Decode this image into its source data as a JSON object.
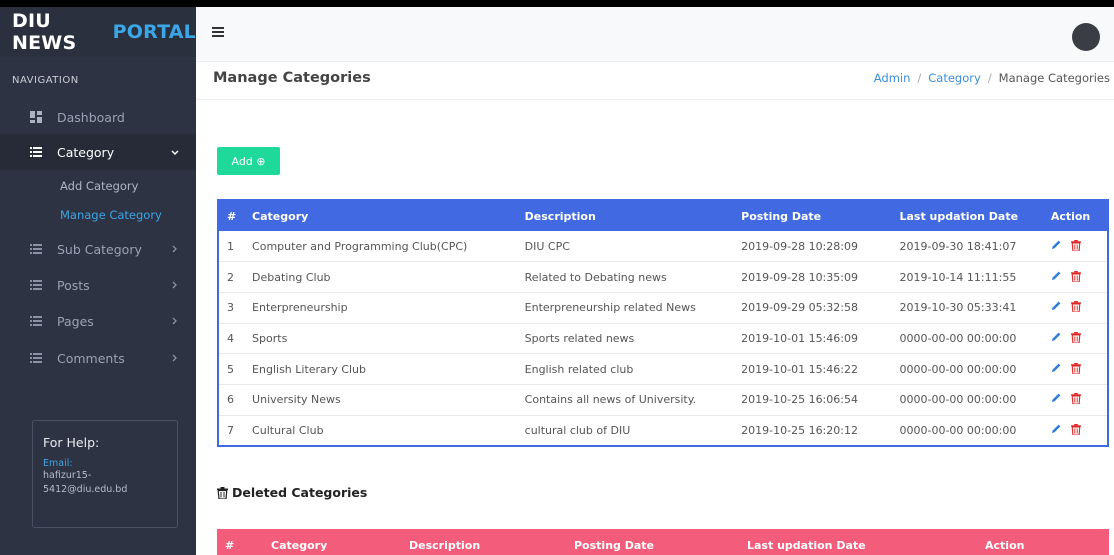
{
  "brand": {
    "primary": "DIU NEWS",
    "accent": "PORTAL"
  },
  "sidebar": {
    "nav_header": "NAVIGATION",
    "items": [
      {
        "label": "Dashboard",
        "icon": "dashboard-icon"
      },
      {
        "label": "Category",
        "icon": "list-icon",
        "expanded": true
      },
      {
        "label": "Sub Category",
        "icon": "list-icon"
      },
      {
        "label": "Posts",
        "icon": "list-icon"
      },
      {
        "label": "Pages",
        "icon": "list-icon"
      },
      {
        "label": "Comments",
        "icon": "list-icon"
      }
    ],
    "category_sub": [
      {
        "label": "Add Category"
      },
      {
        "label": "Manage Category"
      }
    ],
    "help": {
      "title": "For Help:",
      "email_label": "Email:",
      "email_line1": "hafizur15-",
      "email_line2": "5412@diu.edu.bd"
    }
  },
  "header": {
    "page_title": "Manage Categories",
    "breadcrumb": [
      "Admin",
      "Category",
      "Manage Categories"
    ]
  },
  "main": {
    "add_button": "Add ⊕",
    "table": {
      "headers": [
        "#",
        "Category",
        "Description",
        "Posting Date",
        "Last updation Date",
        "Action"
      ],
      "rows": [
        [
          "1",
          "Computer and Programming Club(CPC)",
          "DIU CPC",
          "2019-09-28 10:28:09",
          "2019-09-30 18:41:07"
        ],
        [
          "2",
          "Debating Club",
          "Related to Debating news",
          "2019-09-28 10:35:09",
          "2019-10-14 11:11:55"
        ],
        [
          "3",
          "Enterpreneurship",
          "Enterpreneurship related News",
          "2019-09-29 05:32:58",
          "2019-10-30 05:33:41"
        ],
        [
          "4",
          "Sports",
          "Sports related news",
          "2019-10-01 15:46:09",
          "0000-00-00 00:00:00"
        ],
        [
          "5",
          "English Literary Club",
          "English related club",
          "2019-10-01 15:46:22",
          "0000-00-00 00:00:00"
        ],
        [
          "6",
          "University News",
          "Contains all news of University.",
          "2019-10-25 16:06:54",
          "0000-00-00 00:00:00"
        ],
        [
          "7",
          "Cultural Club",
          "cultural club of DIU",
          "2019-10-25 16:20:12",
          "0000-00-00 00:00:00"
        ]
      ]
    },
    "deleted_title": "Deleted Categories",
    "deleted_table": {
      "headers": [
        "#",
        "Category",
        "Description",
        "Posting Date",
        "Last updation Date",
        "Action"
      ]
    }
  },
  "colors": {
    "sidebar_bg": "#2d3342",
    "brand_accent": "#3ba7e8",
    "table_header": "#4169e1",
    "deleted_header": "#f35d7b",
    "add_button": "#1fd99b",
    "edit_icon": "#2f7ddb",
    "delete_icon": "#e02424"
  }
}
